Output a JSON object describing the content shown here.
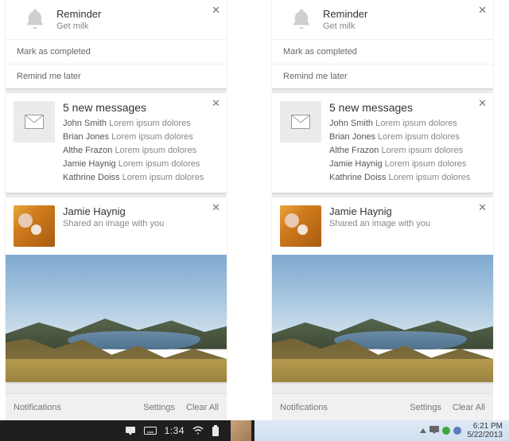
{
  "reminder": {
    "title": "Reminder",
    "subtitle": "Get milk",
    "action_complete": "Mark as completed",
    "action_later": "Remind me later"
  },
  "messages": {
    "title": "5 new messages",
    "items": [
      {
        "from": "John Smith",
        "preview": "Lorem ipsum dolores"
      },
      {
        "from": "Brian Jones",
        "preview": "Lorem ipsum dolores"
      },
      {
        "from": "Althe Frazon",
        "preview": "Lorem ipsum dolores"
      },
      {
        "from": "Jamie Haynig",
        "preview": "Lorem ipsum dolores"
      },
      {
        "from": "Kathrine Doiss",
        "preview": "Lorem ipsum dolores"
      }
    ]
  },
  "share": {
    "name": "Jamie Haynig",
    "subtitle": "Shared an image with you"
  },
  "footer": {
    "notifications": "Notifications",
    "settings": "Settings",
    "clear_all": "Clear All"
  },
  "taskbar_chrome": {
    "time": "1:34"
  },
  "taskbar_win": {
    "time": "6:21 PM",
    "date": "5/22/2013"
  }
}
